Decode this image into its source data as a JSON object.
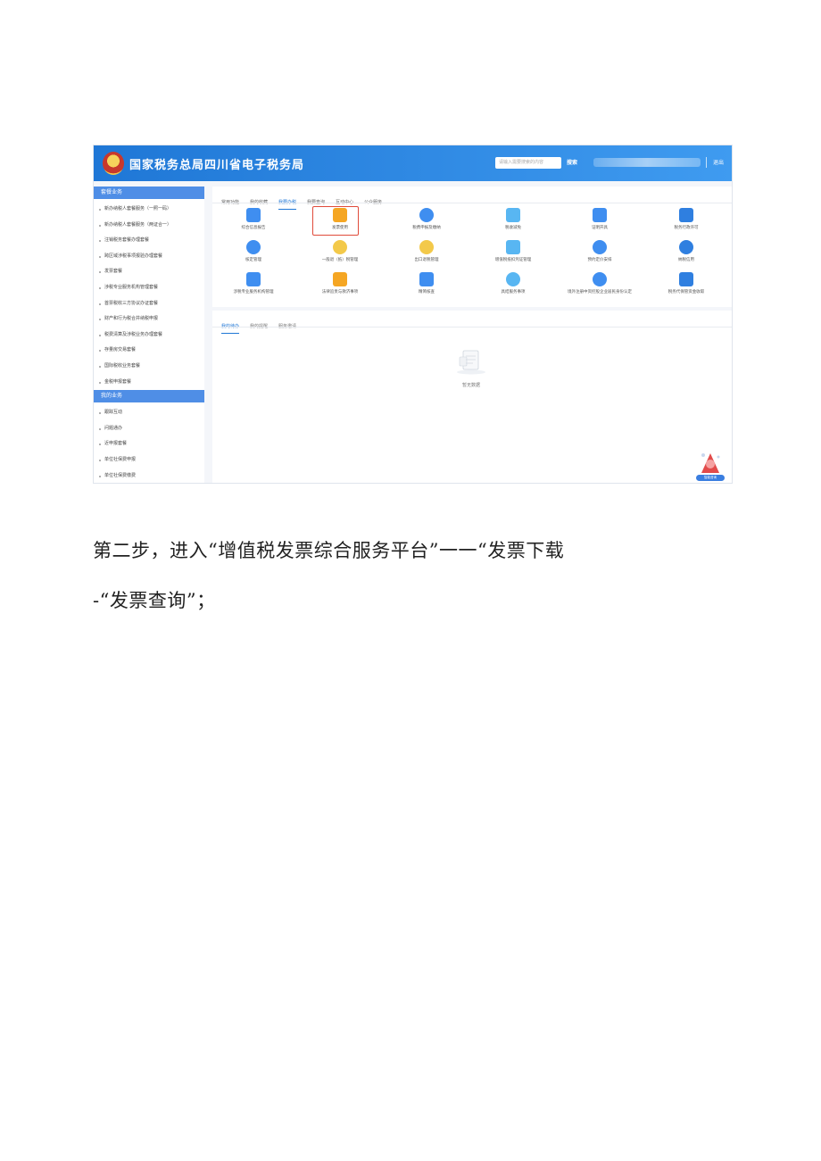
{
  "screenshot": {
    "site_title": "国家税务总局四川省电子税务局",
    "search_placeholder": "请输入需要搜索的内容",
    "search_button": "搜索",
    "logout": "退出",
    "colors": {
      "header": "#1f77d6",
      "accent": "#1f77d6",
      "highlight": "#e04a3a",
      "sidebar_head": "#4f8ee6"
    },
    "sidebar": {
      "section1": "套餐业务",
      "items1": [
        "新办纳税人套餐服务（一照一码）",
        "新办纳税人套餐服务（两证合一）",
        "注销税务套餐办理套餐",
        "跨区域涉税事项报验办理套餐",
        "发票套餐",
        "涉税专业服务机构管理套餐",
        "首票税收三方协议办证套餐",
        "财产和行为税合并纳税申报",
        "税费清算及涉税业务办理套餐",
        "存量房交易套餐",
        "国际税收业务套餐",
        "金税申报套餐"
      ],
      "section2": "我的业务",
      "items2": [
        "跟踪互动",
        "问题通办",
        "近申报套餐",
        "单位社保费申报",
        "单位社保费缴费"
      ]
    },
    "tabs": [
      "常用功能",
      "我的收藏",
      "我要办税",
      "我要查询",
      "互动中心",
      "公众服务"
    ],
    "active_tab": "我要办税",
    "grid": [
      {
        "label": "综合信息报告",
        "icon": "document-icon"
      },
      {
        "label": "发票使用",
        "icon": "invoice-icon"
      },
      {
        "label": "税费申报及缴纳",
        "icon": "cloud-coin-icon"
      },
      {
        "label": "税收减免",
        "icon": "calculator-icon"
      },
      {
        "label": "证明开具",
        "icon": "certificate-icon"
      },
      {
        "label": "税务行政许可",
        "icon": "permit-icon"
      },
      {
        "label": "核定管理",
        "icon": "user-circle-icon"
      },
      {
        "label": "一般退（抵）税管理",
        "icon": "refund-icon"
      },
      {
        "label": "出口退税管理",
        "icon": "export-icon"
      },
      {
        "label": "增值税抵扣凭证管理",
        "icon": "voucher-icon"
      },
      {
        "label": "预约定价安排",
        "icon": "camera-icon"
      },
      {
        "label": "纳税信用",
        "icon": "medal-icon"
      },
      {
        "label": "涉税专业服务机构管理",
        "icon": "building-icon"
      },
      {
        "label": "法律追责与救济事项",
        "icon": "gavel-icon"
      },
      {
        "label": "精简核查",
        "icon": "monitor-icon"
      },
      {
        "label": "具结服务事项",
        "icon": "heart-hand-icon"
      },
      {
        "label": "境外注册中资控股企业居民身份认定",
        "icon": "person-badge-icon"
      },
      {
        "label": "税务代保管资金收取",
        "icon": "safe-icon"
      }
    ],
    "todo_tabs": [
      "我的待办",
      "我的提醒",
      "服务邀请"
    ],
    "active_todo": "我的待办",
    "empty_text": "暂无数据",
    "assistant_label": "智能咨询"
  },
  "text": {
    "line1": "第二步，进入“增值税发票综合服务平台”一一“发票下载",
    "line2": "-“发票查询”；"
  }
}
